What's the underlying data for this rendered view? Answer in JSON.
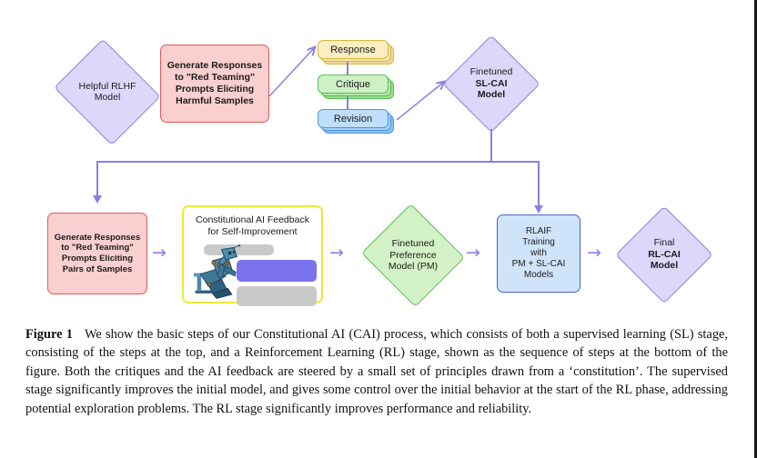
{
  "figure": {
    "nodes": {
      "helpful_rlhf": {
        "label_lines": [
          "Helpful RLHF",
          "Model"
        ],
        "shape": "diamond",
        "color": "#ddd7fa",
        "border": "#8c7fe0"
      },
      "generate_harmful": {
        "label_lines": [
          "Generate Responses",
          "to \"Red Teaming\"",
          "Prompts Eliciting",
          "Harmful Samples"
        ],
        "shape": "rect",
        "color": "#f9cfcf",
        "border": "#e05a5a"
      },
      "response": {
        "label": "Response",
        "shape": "stacked-card",
        "color": "#fbeec2",
        "border": "#d6b63c"
      },
      "critique": {
        "label": "Critique",
        "shape": "stacked-card",
        "color": "#cdf0c5",
        "border": "#56c055"
      },
      "revision": {
        "label": "Revision",
        "shape": "stacked-card",
        "color": "#bfdefb",
        "border": "#4f96e0"
      },
      "finetuned_slcai": {
        "label_lines": [
          "Finetuned",
          "SL-CAI",
          "Model"
        ],
        "bold_lines": [
          false,
          true,
          true
        ],
        "shape": "diamond",
        "color": "#ddd7fa",
        "border": "#8c7fe0"
      },
      "generate_pairs": {
        "label_lines": [
          "Generate Responses",
          "to \"Red Teaming\"",
          "Prompts Eliciting",
          "Pairs of Samples"
        ],
        "shape": "rect",
        "color": "#f9cfcf",
        "border": "#e05a5a"
      },
      "cai_feedback": {
        "title_lines": [
          "Constitutional AI Feedback",
          "for Self-Improvement"
        ],
        "shape": "panel",
        "color": "#ffffff",
        "border": "#e9e93c"
      },
      "finetuned_pm": {
        "label_lines": [
          "Finetuned",
          "Preference",
          "Model (PM)"
        ],
        "shape": "diamond",
        "color": "#d4f2c7",
        "border": "#59bf52"
      },
      "rlaif_training": {
        "label_lines": [
          "RLAIF",
          "Training",
          "with",
          "PM + SL-CAI",
          "Models"
        ],
        "shape": "rect",
        "color": "#cfe4fb",
        "border": "#4a63c8"
      },
      "final_rlcai": {
        "label_lines": [
          "Final",
          "RL-CAI",
          "Model"
        ],
        "bold_lines": [
          false,
          true,
          true
        ],
        "shape": "diamond",
        "color": "#ddd7fa",
        "border": "#8c7fe0"
      }
    },
    "connectors": {
      "arrow_glyph": "→",
      "color": "#8c7fe0"
    }
  },
  "caption": {
    "label": "Figure 1",
    "text": "We show the basic steps of our Constitutional AI (CAI) process, which consists of both a supervised learning (SL) stage, consisting of the steps at the top, and a Reinforcement Learning (RL) stage, shown as the sequence of steps at the bottom of the figure.  Both the critiques and the AI feedback are steered by a small set of principles drawn from a ‘constitution’. The supervised stage significantly improves the initial model, and gives some control over the initial behavior at the start of the RL phase, addressing potential exploration problems. The RL stage significantly improves performance and reliability."
  }
}
